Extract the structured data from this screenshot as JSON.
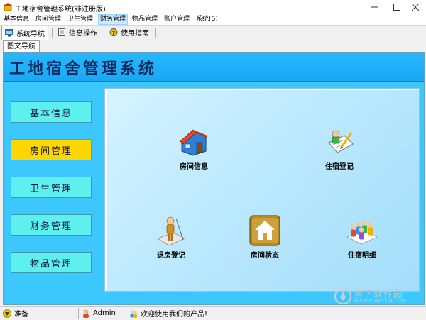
{
  "window": {
    "title": "工地宿舍管理系统(非注册版)"
  },
  "menu": [
    "基本信息",
    "房间管理",
    "卫生管理",
    "财务管理",
    "物品管理",
    "账户管理",
    "系统(S)"
  ],
  "toolbar": {
    "tabs": [
      "系统导航",
      "信息操作",
      "使用指南"
    ]
  },
  "subtab": "图文导航",
  "app": {
    "heading": "工地宿舍管理系统"
  },
  "nav": [
    "基本信息",
    "房间管理",
    "卫生管理",
    "财务管理",
    "物品管理"
  ],
  "functions": [
    "房间信息",
    "住宿登记",
    "退房登记",
    "房间状态",
    "住宿明细"
  ],
  "status": {
    "ready": "准备",
    "user": "Admin",
    "welcome": "欢迎使用我们的产品!"
  },
  "watermark": {
    "text": "当下软件园",
    "url": "www.downxia.com"
  },
  "colors": {
    "header": "#1aa8f5",
    "nav_button": "#5ef0ef",
    "nav_active": "#ffd600",
    "content": "#bfeaff"
  }
}
